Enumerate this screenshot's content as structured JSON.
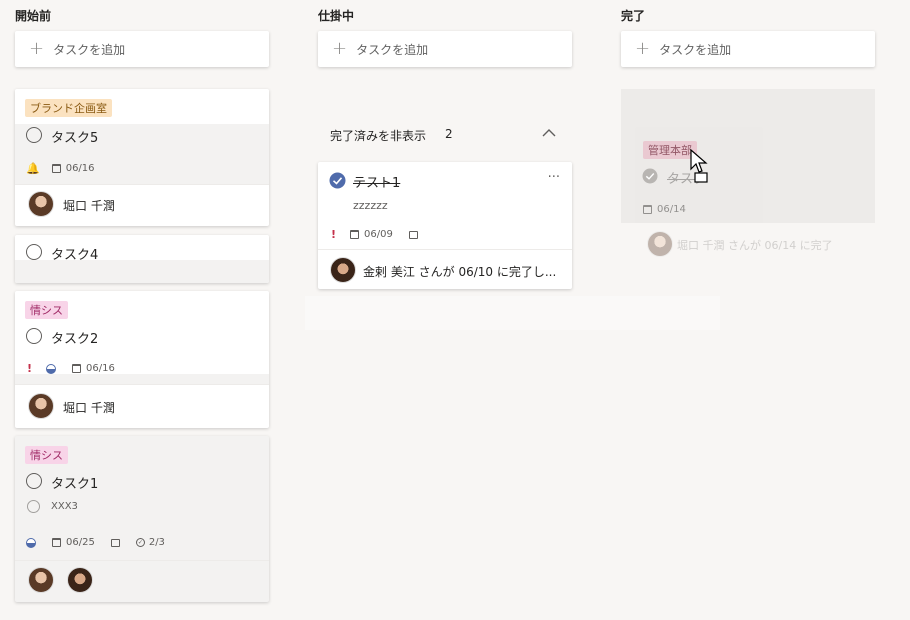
{
  "columns": [
    {
      "title": "開始前"
    },
    {
      "title": "仕掛中"
    },
    {
      "title": "完了"
    }
  ],
  "add_task_label": "タスクを追加",
  "cards": {
    "task5": {
      "label": "ブランド企画室",
      "title": "タスク5",
      "due": "06/16",
      "assignee": "堀口 千潤"
    },
    "task4": {
      "title": "タスク4"
    },
    "task2": {
      "label": "情シス",
      "title": "タスク2",
      "due": "06/16",
      "assignee": "堀口 千潤"
    },
    "task1": {
      "label": "情シス",
      "title": "タスク1",
      "checklist_item": "XXX3",
      "due": "06/25",
      "checklist_count": "2/3"
    }
  },
  "in_progress": {
    "completed_toggle_label": "完了済みを非表示",
    "completed_count": "2",
    "test_card": {
      "title": "テスト1",
      "notes": "zzzzzz",
      "due": "06/09",
      "more": "···",
      "completion_text": "金剌 美江 さんが 06/10 に完了し..."
    }
  },
  "done": {
    "dragging_card": {
      "label": "管理本部",
      "title": "タスク",
      "due": "06/14",
      "assignee_text": "堀口 千潤 さんが 06/14 に完了"
    }
  },
  "colors": {
    "background": "#f8f6f4",
    "card": "#ffffff",
    "accent": "#4f6bab",
    "priority": "#c4314b"
  }
}
